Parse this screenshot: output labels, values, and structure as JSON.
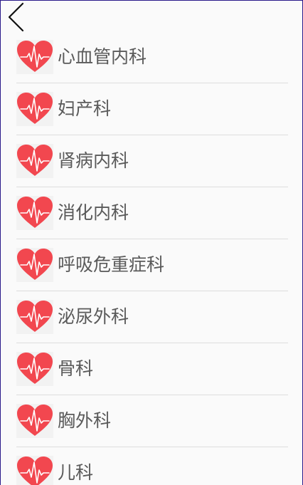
{
  "header": {
    "back_icon": "chevron-left-icon"
  },
  "colors": {
    "heart": "#f2474f",
    "pulse_line": "#ffffff",
    "label_text": "#5a5a5a",
    "divider": "#dddddd",
    "background": "#fafafa"
  },
  "departments": [
    {
      "label": "心血管内科",
      "icon": "heart-pulse-icon"
    },
    {
      "label": "妇产科",
      "icon": "heart-pulse-icon"
    },
    {
      "label": "肾病内科",
      "icon": "heart-pulse-icon"
    },
    {
      "label": "消化内科",
      "icon": "heart-pulse-icon"
    },
    {
      "label": "呼吸危重症科",
      "icon": "heart-pulse-icon"
    },
    {
      "label": "泌尿外科",
      "icon": "heart-pulse-icon"
    },
    {
      "label": "骨科",
      "icon": "heart-pulse-icon"
    },
    {
      "label": "胸外科",
      "icon": "heart-pulse-icon"
    },
    {
      "label": "儿科",
      "icon": "heart-pulse-icon"
    }
  ]
}
